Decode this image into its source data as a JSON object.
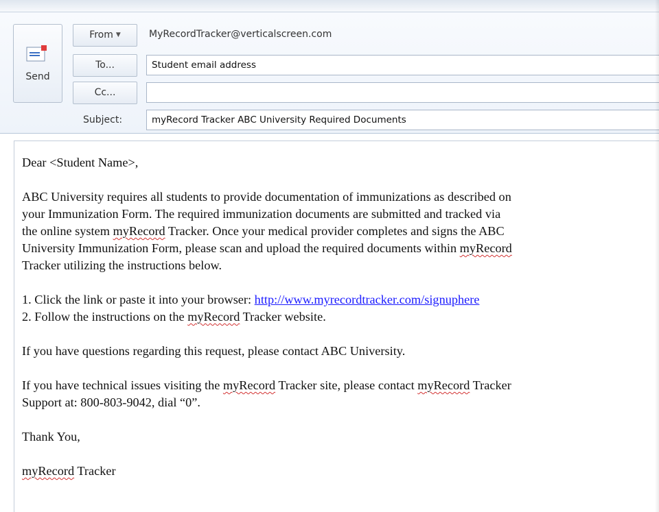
{
  "header": {
    "send_label": "Send",
    "from_label": "From",
    "from_value": "MyRecordTracker@verticalscreen.com",
    "to_label": "To...",
    "to_value": "Student email address",
    "cc_label": "Cc...",
    "cc_value": "",
    "subject_label": "Subject:",
    "subject_value": "myRecord Tracker ABC University Required Documents"
  },
  "message": {
    "greeting": "Dear <Student Name>,",
    "para1": {
      "l1": "ABC University requires all students to provide documentation of immunizations as described on",
      "l2": "your Immunization Form. The required immunization documents are submitted and tracked via",
      "l3a": "the online system ",
      "l3b": "myRecord",
      "l3c": " Tracker. Once your medical provider completes and signs the ABC",
      "l4a": "University Immunization Form, please scan and upload the required documents within ",
      "l4b": "myRecord",
      "l5": "Tracker utilizing the instructions below."
    },
    "step1_text": "1. Click the link or paste it into your browser: ",
    "step1_link": "http://www.myrecordtracker.com/signuphere",
    "step2a": "2. Follow the instructions on the ",
    "step2b": "myRecord",
    "step2c": " Tracker website.",
    "questions": "If you have questions regarding this request, please contact ABC University.",
    "tech": {
      "l1a": "If you have technical issues visiting the ",
      "l1b": "myRecord",
      "l1c": " Tracker site, please contact ",
      "l1d": "myRecord",
      "l1e": " Tracker",
      "l2": "Support at: 800-803-9042, dial “0”."
    },
    "closing": "Thank You,",
    "signature_a": "myRecord",
    "signature_b": " Tracker"
  },
  "icons": {
    "send": "send-envelope-icon",
    "from_dropdown": "chevron-down-icon"
  },
  "colors": {
    "link": "#1a1aff",
    "spellcheck": "#d23131"
  }
}
